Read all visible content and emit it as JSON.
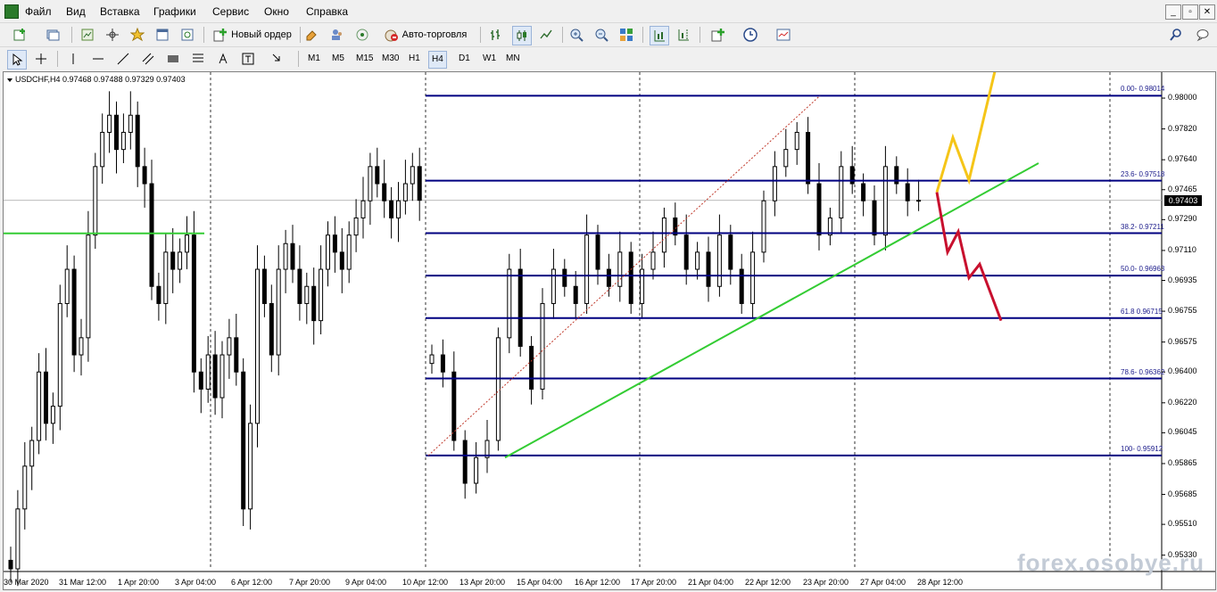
{
  "menu": [
    "Файл",
    "Вид",
    "Вставка",
    "Графики",
    "Сервис",
    "Окно",
    "Справка"
  ],
  "window_buttons": [
    "_",
    "▫",
    "✕"
  ],
  "toolbar": {
    "new_order": "Новый ордер",
    "autotrading": "Авто-торговля"
  },
  "timeframes": [
    "M1",
    "M5",
    "M15",
    "M30",
    "H1",
    "H4",
    "D1",
    "W1",
    "MN"
  ],
  "active_timeframe": "H4",
  "chart": {
    "symbol_info": "USDCHF,H4  0.97468 0.97488 0.97329 0.97403",
    "current_price": "0.97403",
    "watermark": "forex.osobye.ru",
    "colors": {
      "fibo": "#000080",
      "trendline": "#33cc33",
      "forecast_up": "#f5c518",
      "forecast_down": "#c8102e"
    }
  },
  "chart_data": {
    "type": "candlestick",
    "symbol": "USDCHF",
    "timeframe": "H4",
    "y_ticks": [
      "0.98000",
      "0.97820",
      "0.97640",
      "0.97465",
      "0.97290",
      "0.97110",
      "0.96935",
      "0.96755",
      "0.96575",
      "0.96400",
      "0.96220",
      "0.96045",
      "0.95865",
      "0.95685",
      "0.95510",
      "0.95330"
    ],
    "x_ticks": [
      "30 Mar 2020",
      "31 Mar 12:00",
      "1 Apr 20:00",
      "3 Apr 04:00",
      "6 Apr 12:00",
      "7 Apr 20:00",
      "9 Apr 04:00",
      "10 Apr 12:00",
      "13 Apr 20:00",
      "15 Apr 04:00",
      "16 Apr 12:00",
      "17 Apr 20:00",
      "21 Apr 04:00",
      "22 Apr 12:00",
      "23 Apr 20:00",
      "27 Apr 04:00",
      "28 Apr 12:00"
    ],
    "fibonacci": [
      {
        "label": "0.00- 0.98014",
        "level": 0.98014
      },
      {
        "label": "23.6- 0.97518",
        "level": 0.97518
      },
      {
        "label": "38.2- 0.97211",
        "level": 0.97211
      },
      {
        "label": "50.0- 0.96963",
        "level": 0.96963
      },
      {
        "label": "61.8 0.96715",
        "level": 0.96715
      },
      {
        "label": "78.6- 0.96362",
        "level": 0.96362
      },
      {
        "label": "100- 0.95912",
        "level": 0.95912
      }
    ],
    "support_level": 0.9721,
    "closes": [
      0.9525,
      0.956,
      0.9585,
      0.96,
      0.964,
      0.961,
      0.962,
      0.968,
      0.97,
      0.965,
      0.966,
      0.972,
      0.976,
      0.978,
      0.979,
      0.977,
      0.978,
      0.979,
      0.976,
      0.975,
      0.969,
      0.968,
      0.971,
      0.97,
      0.971,
      0.972,
      0.964,
      0.963,
      0.965,
      0.9625,
      0.965,
      0.966,
      0.964,
      0.956,
      0.961,
      0.97,
      0.968,
      0.965,
      0.97,
      0.9715,
      0.97,
      0.968,
      0.969,
      0.967,
      0.97,
      0.972,
      0.971,
      0.97,
      0.972,
      0.973,
      0.974,
      0.976,
      0.975,
      0.974,
      0.973,
      0.974,
      0.975,
      0.976,
      0.97403
    ],
    "forecast_up": [
      0.9745,
      0.9777,
      0.9752,
      0.982
    ],
    "forecast_down": [
      0.9745,
      0.971,
      0.9722,
      0.9695,
      0.9703,
      0.967
    ]
  }
}
